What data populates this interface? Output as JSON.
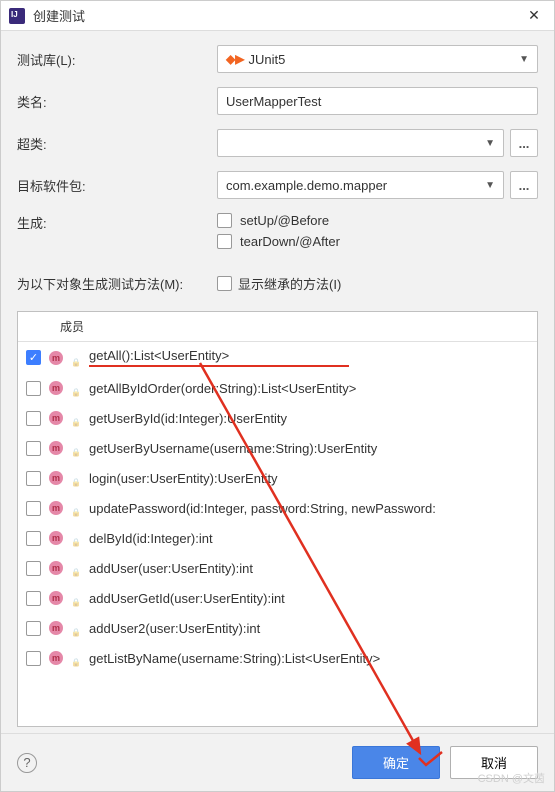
{
  "window": {
    "title": "创建测试"
  },
  "labels": {
    "testLib": "测试库(L):",
    "className": "类名:",
    "superClass": "超类:",
    "targetPkg": "目标软件包:",
    "generate": "生成:",
    "genMethodsFor": "为以下对象生成测试方法(M):",
    "membersHeader": "成员"
  },
  "fields": {
    "testLib": "JUnit5",
    "className": "UserMapperTest",
    "superClass": "",
    "targetPkg": "com.example.demo.mapper"
  },
  "generateOpts": {
    "setup": {
      "label": "setUp/@Before",
      "checked": false
    },
    "teardown": {
      "label": "tearDown/@After",
      "checked": false
    },
    "showInherited": {
      "label": "显示继承的方法(I)",
      "checked": false
    }
  },
  "methods": [
    {
      "checked": true,
      "sig": "getAll():List<UserEntity>",
      "highlight": true
    },
    {
      "checked": false,
      "sig": "getAllByIdOrder(order:String):List<UserEntity>"
    },
    {
      "checked": false,
      "sig": "getUserById(id:Integer):UserEntity"
    },
    {
      "checked": false,
      "sig": "getUserByUsername(username:String):UserEntity"
    },
    {
      "checked": false,
      "sig": "login(user:UserEntity):UserEntity"
    },
    {
      "checked": false,
      "sig": "updatePassword(id:Integer, password:String, newPassword:"
    },
    {
      "checked": false,
      "sig": "delById(id:Integer):int"
    },
    {
      "checked": false,
      "sig": "addUser(user:UserEntity):int"
    },
    {
      "checked": false,
      "sig": "addUserGetId(user:UserEntity):int"
    },
    {
      "checked": false,
      "sig": "addUser2(user:UserEntity):int"
    },
    {
      "checked": false,
      "sig": "getListByName(username:String):List<UserEntity>"
    }
  ],
  "buttons": {
    "ok": "确定",
    "cancel": "取消",
    "ellipsis": "..."
  },
  "watermark": "CSDN @文茵"
}
